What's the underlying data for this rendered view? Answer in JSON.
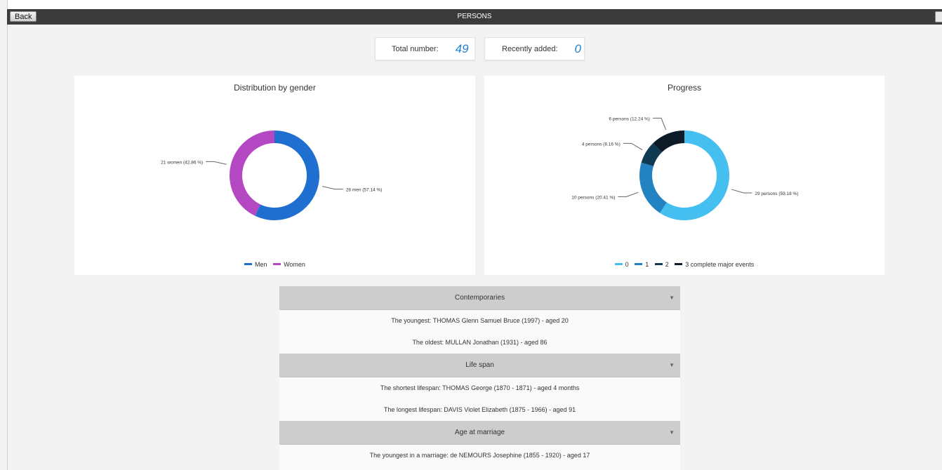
{
  "window": {
    "title": "PERSONS",
    "back_label": "Back"
  },
  "stats": {
    "total_label": "Total number:",
    "total_value": "49",
    "recent_label": "Recently added:",
    "recent_value": "0"
  },
  "colors": {
    "accent": "#1f7fd0",
    "men": "#1f6fd1",
    "women": "#b447c2",
    "progress_0": "#45bfef",
    "progress_1": "#2383c2",
    "progress_2": "#0f3a52",
    "progress_3": "#0c1b27"
  },
  "gender_chart": {
    "title": "Distribution by gender",
    "legend": [
      {
        "label": "Men",
        "color": "#1f6fd1"
      },
      {
        "label": "Women",
        "color": "#b447c2"
      }
    ]
  },
  "progress_chart": {
    "title": "Progress",
    "legend": [
      {
        "label": "0",
        "color": "#45bfef"
      },
      {
        "label": "1",
        "color": "#2383c2"
      },
      {
        "label": "2",
        "color": "#0f3a52"
      },
      {
        "label": "3 complete major events",
        "color": "#0c1b27"
      }
    ]
  },
  "chart_data": [
    {
      "type": "pie",
      "donut": true,
      "title": "Distribution by gender",
      "categories": [
        "Men",
        "Women"
      ],
      "values": [
        28,
        21
      ],
      "slice_labels": [
        "28 men (57.14 %)",
        "21 women (42.86 %)"
      ],
      "colors": [
        "#1f6fd1",
        "#b447c2"
      ],
      "legend_position": "bottom"
    },
    {
      "type": "pie",
      "donut": true,
      "title": "Progress",
      "categories": [
        "0",
        "1",
        "2",
        "3 complete major events"
      ],
      "values": [
        29,
        10,
        4,
        6
      ],
      "slice_labels": [
        "29 persons (59.18 %)",
        "10 persons (20.41 %)",
        "4 persons (8.16 %)",
        "6 persons (12.24 %)"
      ],
      "colors": [
        "#45bfef",
        "#2383c2",
        "#0f3a52",
        "#0c1b27"
      ],
      "legend_position": "bottom"
    }
  ],
  "accordion": [
    {
      "title": "Contemporaries",
      "rows": [
        "The youngest: THOMAS Glenn Samuel Bruce (1997) - aged 20",
        "The oldest: MULLAN Jonathan (1931) - aged 86"
      ]
    },
    {
      "title": "Life span",
      "rows": [
        "The shortest lifespan: THOMAS George (1870 - 1871) - aged 4 months",
        "The longest lifespan: DAVIS Violet Elizabeth (1875 - 1966) - aged 91"
      ]
    },
    {
      "title": "Age at marriage",
      "rows": [
        "The youngest in a marriage: de NEMOURS Josephine (1855 - 1920) - aged 17"
      ]
    }
  ]
}
